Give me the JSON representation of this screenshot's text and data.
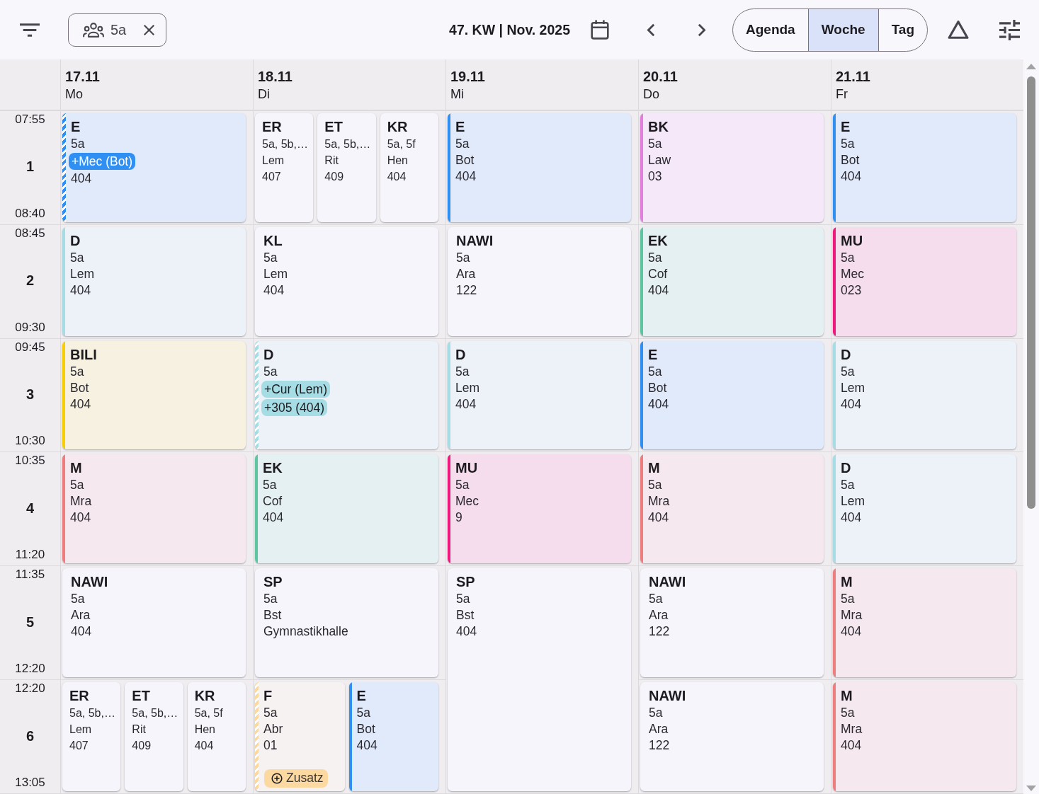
{
  "toolbar": {
    "class_filter": {
      "label": "5a"
    },
    "week_label": "47. KW | Nov. 2025",
    "views": [
      {
        "label": "Agenda",
        "selected": false
      },
      {
        "label": "Woche",
        "selected": true
      },
      {
        "label": "Tag",
        "selected": false
      }
    ]
  },
  "periods": [
    {
      "number": "1",
      "start": "07:55",
      "end": "08:40"
    },
    {
      "number": "2",
      "start": "08:45",
      "end": "09:30"
    },
    {
      "number": "3",
      "start": "09:45",
      "end": "10:30"
    },
    {
      "number": "4",
      "start": "10:35",
      "end": "11:20"
    },
    {
      "number": "5",
      "start": "11:35",
      "end": "12:20"
    },
    {
      "number": "6",
      "start": "12:20",
      "end": "13:05"
    }
  ],
  "days": [
    {
      "date": "17.11",
      "weekday": "Mo",
      "blocks": [
        {
          "kind": "single",
          "lessons": [
            {
              "subject": "E",
              "color": "#2f8ff2",
              "changed": true,
              "lines": [
                {
                  "kind": "plain",
                  "text": "5a"
                },
                {
                  "kind": "change",
                  "text": "+Mec (Bot)"
                },
                {
                  "kind": "plain",
                  "text": "404"
                }
              ]
            }
          ]
        },
        {
          "kind": "single",
          "lessons": [
            {
              "subject": "D",
              "color": "#a6dce3",
              "changed": false,
              "lines": [
                {
                  "kind": "plain",
                  "text": "5a"
                },
                {
                  "kind": "plain",
                  "text": "Lem"
                },
                {
                  "kind": "plain",
                  "text": "404"
                }
              ]
            }
          ]
        },
        {
          "kind": "single",
          "lessons": [
            {
              "subject": "BILI",
              "color": "#f8cf05",
              "changed": false,
              "lines": [
                {
                  "kind": "plain",
                  "text": "5a"
                },
                {
                  "kind": "plain",
                  "text": "Bot"
                },
                {
                  "kind": "plain",
                  "text": "404"
                }
              ]
            }
          ]
        },
        {
          "kind": "single",
          "lessons": [
            {
              "subject": "M",
              "color": "#ee7d7d",
              "changed": false,
              "lines": [
                {
                  "kind": "plain",
                  "text": "5a"
                },
                {
                  "kind": "plain",
                  "text": "Mra"
                },
                {
                  "kind": "plain",
                  "text": "404"
                }
              ]
            }
          ]
        },
        {
          "kind": "single",
          "lessons": [
            {
              "subject": "NAWI",
              "changed": false,
              "lines": [
                {
                  "kind": "plain",
                  "text": "5a"
                },
                {
                  "kind": "plain",
                  "text": "Ara"
                },
                {
                  "kind": "plain",
                  "text": "404"
                }
              ]
            }
          ]
        },
        {
          "kind": "single",
          "lessons": [
            {
              "subject": "ER",
              "changed": false,
              "lines": [
                {
                  "kind": "plain",
                  "text": "5a, 5b,…"
                },
                {
                  "kind": "plain",
                  "text": "Lem"
                },
                {
                  "kind": "plain",
                  "text": "407"
                }
              ]
            },
            {
              "subject": "ET",
              "changed": false,
              "lines": [
                {
                  "kind": "plain",
                  "text": "5a, 5b,…"
                },
                {
                  "kind": "plain",
                  "text": "Rit"
                },
                {
                  "kind": "plain",
                  "text": "409"
                }
              ]
            },
            {
              "subject": "KR",
              "changed": false,
              "lines": [
                {
                  "kind": "plain",
                  "text": "5a, 5f"
                },
                {
                  "kind": "plain",
                  "text": "Hen"
                },
                {
                  "kind": "plain",
                  "text": "404"
                }
              ]
            }
          ]
        }
      ]
    },
    {
      "date": "18.11",
      "weekday": "Di",
      "blocks": [
        {
          "kind": "single",
          "lessons": [
            {
              "subject": "ER",
              "changed": false,
              "lines": [
                {
                  "kind": "plain",
                  "text": "5a, 5b,…"
                },
                {
                  "kind": "plain",
                  "text": "Lem"
                },
                {
                  "kind": "plain",
                  "text": "407"
                }
              ]
            },
            {
              "subject": "ET",
              "changed": false,
              "lines": [
                {
                  "kind": "plain",
                  "text": "5a, 5b,…"
                },
                {
                  "kind": "plain",
                  "text": "Rit"
                },
                {
                  "kind": "plain",
                  "text": "409"
                }
              ]
            },
            {
              "subject": "KR",
              "changed": false,
              "lines": [
                {
                  "kind": "plain",
                  "text": "5a, 5f"
                },
                {
                  "kind": "plain",
                  "text": "Hen"
                },
                {
                  "kind": "plain",
                  "text": "404"
                }
              ]
            }
          ]
        },
        {
          "kind": "single",
          "lessons": [
            {
              "subject": "KL",
              "changed": false,
              "lines": [
                {
                  "kind": "plain",
                  "text": "5a"
                },
                {
                  "kind": "plain",
                  "text": "Lem"
                },
                {
                  "kind": "plain",
                  "text": "404"
                }
              ]
            }
          ]
        },
        {
          "kind": "single",
          "lessons": [
            {
              "subject": "D",
              "color": "#a6dce3",
              "changed": true,
              "lines": [
                {
                  "kind": "plain",
                  "text": "5a"
                },
                {
                  "kind": "change",
                  "text": "+Cur (Lem)"
                },
                {
                  "kind": "change",
                  "text": "+305 (404)"
                }
              ]
            }
          ]
        },
        {
          "kind": "single",
          "lessons": [
            {
              "subject": "EK",
              "color": "#5cc6a0",
              "changed": false,
              "lines": [
                {
                  "kind": "plain",
                  "text": "5a"
                },
                {
                  "kind": "plain",
                  "text": "Cof"
                },
                {
                  "kind": "plain",
                  "text": "404"
                }
              ]
            }
          ]
        },
        {
          "kind": "single",
          "lessons": [
            {
              "subject": "SP",
              "changed": false,
              "lines": [
                {
                  "kind": "plain",
                  "text": "5a"
                },
                {
                  "kind": "plain",
                  "text": "Bst"
                },
                {
                  "kind": "plain",
                  "text": "Gymnastikhalle"
                }
              ]
            }
          ]
        },
        {
          "kind": "single",
          "lessons": [
            {
              "subject": "F",
              "color": "#fdd9a2",
              "changed": true,
              "tag": "Zusatz",
              "lines": [
                {
                  "kind": "plain",
                  "text": "5a"
                },
                {
                  "kind": "plain",
                  "text": "Abr"
                },
                {
                  "kind": "plain",
                  "text": "01"
                }
              ]
            },
            {
              "subject": "E",
              "color": "#2f8ff2",
              "changed": false,
              "lines": [
                {
                  "kind": "plain",
                  "text": "5a"
                },
                {
                  "kind": "plain",
                  "text": "Bot"
                },
                {
                  "kind": "plain",
                  "text": "404"
                }
              ]
            }
          ]
        }
      ]
    },
    {
      "date": "19.11",
      "weekday": "Mi",
      "blocks": [
        {
          "kind": "single",
          "lessons": [
            {
              "subject": "E",
              "color": "#2f8ff2",
              "changed": false,
              "lines": [
                {
                  "kind": "plain",
                  "text": "5a"
                },
                {
                  "kind": "plain",
                  "text": "Bot"
                },
                {
                  "kind": "plain",
                  "text": "404"
                }
              ]
            }
          ]
        },
        {
          "kind": "single",
          "lessons": [
            {
              "subject": "NAWI",
              "changed": false,
              "lines": [
                {
                  "kind": "plain",
                  "text": "5a"
                },
                {
                  "kind": "plain",
                  "text": "Ara"
                },
                {
                  "kind": "plain",
                  "text": "122"
                }
              ]
            }
          ]
        },
        {
          "kind": "single",
          "lessons": [
            {
              "subject": "D",
              "color": "#a6dce3",
              "changed": false,
              "lines": [
                {
                  "kind": "plain",
                  "text": "5a"
                },
                {
                  "kind": "plain",
                  "text": "Lem"
                },
                {
                  "kind": "plain",
                  "text": "404"
                }
              ]
            }
          ]
        },
        {
          "kind": "single",
          "lessons": [
            {
              "subject": "MU",
              "color": "#f0187c",
              "changed": false,
              "lines": [
                {
                  "kind": "plain",
                  "text": "5a"
                },
                {
                  "kind": "plain",
                  "text": "Mec"
                },
                {
                  "kind": "plain",
                  "text": "9"
                }
              ]
            }
          ]
        },
        {
          "kind": "double",
          "lessons": [
            {
              "subject": "SP",
              "changed": false,
              "lines": [
                {
                  "kind": "plain",
                  "text": "5a"
                },
                {
                  "kind": "plain",
                  "text": "Bst"
                },
                {
                  "kind": "plain",
                  "text": "404"
                }
              ]
            }
          ]
        }
      ]
    },
    {
      "date": "20.11",
      "weekday": "Do",
      "blocks": [
        {
          "kind": "single",
          "lessons": [
            {
              "subject": "BK",
              "color": "#e27fdd",
              "changed": false,
              "lines": [
                {
                  "kind": "plain",
                  "text": "5a"
                },
                {
                  "kind": "plain",
                  "text": "Law"
                },
                {
                  "kind": "plain",
                  "text": "03"
                }
              ]
            }
          ]
        },
        {
          "kind": "single",
          "lessons": [
            {
              "subject": "EK",
              "color": "#5cc6a0",
              "changed": false,
              "lines": [
                {
                  "kind": "plain",
                  "text": "5a"
                },
                {
                  "kind": "plain",
                  "text": "Cof"
                },
                {
                  "kind": "plain",
                  "text": "404"
                }
              ]
            }
          ]
        },
        {
          "kind": "single",
          "lessons": [
            {
              "subject": "E",
              "color": "#2f8ff2",
              "changed": false,
              "lines": [
                {
                  "kind": "plain",
                  "text": "5a"
                },
                {
                  "kind": "plain",
                  "text": "Bot"
                },
                {
                  "kind": "plain",
                  "text": "404"
                }
              ]
            }
          ]
        },
        {
          "kind": "single",
          "lessons": [
            {
              "subject": "M",
              "color": "#ee7d7d",
              "changed": false,
              "lines": [
                {
                  "kind": "plain",
                  "text": "5a"
                },
                {
                  "kind": "plain",
                  "text": "Mra"
                },
                {
                  "kind": "plain",
                  "text": "404"
                }
              ]
            }
          ]
        },
        {
          "kind": "single",
          "lessons": [
            {
              "subject": "NAWI",
              "changed": false,
              "lines": [
                {
                  "kind": "plain",
                  "text": "5a"
                },
                {
                  "kind": "plain",
                  "text": "Ara"
                },
                {
                  "kind": "plain",
                  "text": "122"
                }
              ]
            }
          ]
        },
        {
          "kind": "single",
          "lessons": [
            {
              "subject": "NAWI",
              "changed": false,
              "lines": [
                {
                  "kind": "plain",
                  "text": "5a"
                },
                {
                  "kind": "plain",
                  "text": "Ara"
                },
                {
                  "kind": "plain",
                  "text": "122"
                }
              ]
            }
          ]
        }
      ]
    },
    {
      "date": "21.11",
      "weekday": "Fr",
      "blocks": [
        {
          "kind": "single",
          "lessons": [
            {
              "subject": "E",
              "color": "#2f8ff2",
              "changed": false,
              "lines": [
                {
                  "kind": "plain",
                  "text": "5a"
                },
                {
                  "kind": "plain",
                  "text": "Bot"
                },
                {
                  "kind": "plain",
                  "text": "404"
                }
              ]
            }
          ]
        },
        {
          "kind": "single",
          "lessons": [
            {
              "subject": "MU",
              "color": "#f0187c",
              "changed": false,
              "lines": [
                {
                  "kind": "plain",
                  "text": "5a"
                },
                {
                  "kind": "plain",
                  "text": "Mec"
                },
                {
                  "kind": "plain",
                  "text": "023"
                }
              ]
            }
          ]
        },
        {
          "kind": "single",
          "lessons": [
            {
              "subject": "D",
              "color": "#a6dce3",
              "changed": false,
              "lines": [
                {
                  "kind": "plain",
                  "text": "5a"
                },
                {
                  "kind": "plain",
                  "text": "Lem"
                },
                {
                  "kind": "plain",
                  "text": "404"
                }
              ]
            }
          ]
        },
        {
          "kind": "single",
          "lessons": [
            {
              "subject": "D",
              "color": "#a6dce3",
              "changed": false,
              "lines": [
                {
                  "kind": "plain",
                  "text": "5a"
                },
                {
                  "kind": "plain",
                  "text": "Lem"
                },
                {
                  "kind": "plain",
                  "text": "404"
                }
              ]
            }
          ]
        },
        {
          "kind": "single",
          "lessons": [
            {
              "subject": "M",
              "color": "#ee7d7d",
              "changed": false,
              "lines": [
                {
                  "kind": "plain",
                  "text": "5a"
                },
                {
                  "kind": "plain",
                  "text": "Mra"
                },
                {
                  "kind": "plain",
                  "text": "404"
                }
              ]
            }
          ]
        },
        {
          "kind": "single",
          "lessons": [
            {
              "subject": "M",
              "color": "#ee7d7d",
              "changed": false,
              "lines": [
                {
                  "kind": "plain",
                  "text": "5a"
                },
                {
                  "kind": "plain",
                  "text": "Mra"
                },
                {
                  "kind": "plain",
                  "text": "404"
                }
              ]
            }
          ]
        }
      ]
    }
  ]
}
